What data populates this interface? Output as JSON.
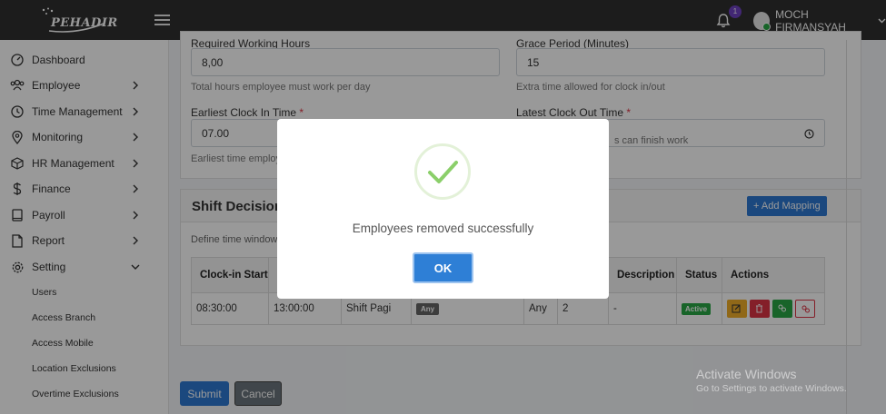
{
  "header": {
    "logo_text": "PEHADIR",
    "notification_count": "1",
    "user_name": "MOCH FIRMANSYAH"
  },
  "sidebar": {
    "items": [
      {
        "label": "Dashboard",
        "icon": "dashboard-icon",
        "has_chevron": false
      },
      {
        "label": "Employee",
        "icon": "users-icon",
        "has_chevron": true
      },
      {
        "label": "Time Management",
        "icon": "clock-icon",
        "has_chevron": true
      },
      {
        "label": "Monitoring",
        "icon": "map-pin-icon",
        "has_chevron": true
      },
      {
        "label": "HR Management",
        "icon": "box-icon",
        "has_chevron": true
      },
      {
        "label": "Finance",
        "icon": "dollar-icon",
        "has_chevron": true
      },
      {
        "label": "Payroll",
        "icon": "book-icon",
        "has_chevron": true
      },
      {
        "label": "Report",
        "icon": "file-icon",
        "has_chevron": true
      },
      {
        "label": "Setting",
        "icon": "gear-icon",
        "has_chevron": true,
        "expanded": true
      }
    ],
    "sub_items": [
      "Users",
      "Access Branch",
      "Access Mobile",
      "Location Exclusions",
      "Overtime Exclusions"
    ]
  },
  "form": {
    "required_hours_label": "Required Working Hours",
    "required_hours_value": "8,00",
    "required_hours_help": "Total hours employee must work per day",
    "grace_label": "Grace Period (Minutes)",
    "grace_value": "15",
    "grace_help": "Extra time allowed for clock in/out",
    "earliest_in_label": "Earliest Clock In Time",
    "earliest_in_value": "07.00",
    "earliest_in_help": "Earliest time employ",
    "latest_out_label": "Latest Clock Out Time",
    "latest_out_help": "s can finish work",
    "required_marker": "*"
  },
  "shift_decision": {
    "title": "Shift Decision I",
    "add_button": "+ Add Mapping",
    "description": "Define time window",
    "columns": [
      "Clock-in Start",
      "",
      "",
      "",
      "",
      "",
      "Description",
      "Status",
      "Actions"
    ],
    "rows": [
      {
        "clock_in_start": "08:30:00",
        "col2": "13:00:00",
        "shift": "Shift Pagi",
        "badge": "Any",
        "col5": "Any",
        "col6": "2",
        "description": "-",
        "status": "Active"
      }
    ]
  },
  "buttons": {
    "submit": "Submit",
    "cancel": "Cancel"
  },
  "watermark": {
    "line1": "Activate Windows",
    "line2": "Go to Settings to activate Windows."
  },
  "modal": {
    "message": "Employees removed successfully",
    "ok": "OK",
    "icon": "success-check-icon"
  },
  "colors": {
    "topbar": "#2f2f2f",
    "primary": "#2e78d2",
    "success": "#28a745",
    "danger": "#dc3545",
    "warning": "#f0ad28",
    "badge": "#6f42c1"
  }
}
